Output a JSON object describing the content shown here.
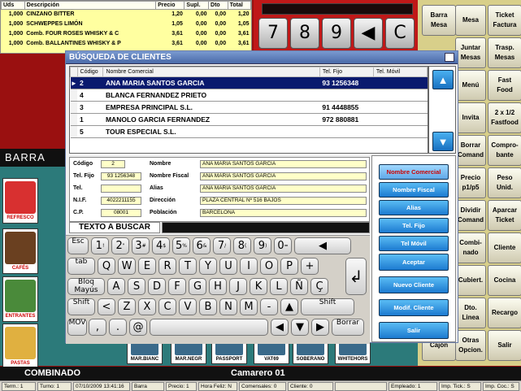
{
  "order": {
    "headers": [
      "Uds",
      "Descripción",
      "Precio",
      "Supl.",
      "Dto",
      "Total"
    ],
    "rows": [
      [
        "1,000",
        "CINZANO BITTER",
        "1,20",
        "0,00",
        "0,00",
        "1,20"
      ],
      [
        "1,000",
        "SCHWEPPES LIMÓN",
        "1,05",
        "0,00",
        "0,00",
        "1,05"
      ],
      [
        "1,000",
        "Comb. FOUR ROSES WHISKY & C",
        "3,61",
        "0,00",
        "0,00",
        "3,61"
      ],
      [
        "1,000",
        "Comb. BALLANTINES WHISKY & P",
        "3,61",
        "0,00",
        "0,00",
        "3,61"
      ]
    ]
  },
  "keypad": [
    "7",
    "8",
    "9",
    "◀",
    "C"
  ],
  "commands": [
    [
      "Barra Mesa",
      "Mesa",
      "Ticket Factura"
    ],
    [
      "",
      "Juntar Mesas",
      "Trasp. Mesas"
    ],
    [
      "",
      "Menú",
      "Fast Food"
    ],
    [
      "",
      "Invita",
      "2 x 1/2 Fastfood"
    ],
    [
      "",
      "Borrar Comand",
      "Compro- bante"
    ],
    [
      "",
      "Precio p1/p5",
      "Peso Unid."
    ],
    [
      "",
      "Dividir Comand",
      "Aparcar Ticket"
    ],
    [
      "",
      "Combi- nado",
      "Cliente"
    ],
    [
      "",
      "Cubiert.",
      "Cocina"
    ],
    [
      "",
      "Dto. Linea",
      "Recargo"
    ],
    [
      "Cajón",
      "Otras Opcion.",
      "Salir"
    ]
  ],
  "barra_label": "BARRA",
  "left_products": [
    "REFRESCO",
    "CAFÉS",
    "ENTRANTES",
    "PASTAS"
  ],
  "bottom_products": [
    "MAR.BIANC",
    "MAR.NEGR",
    "PASSPORT",
    "VAT69",
    "SOBERANO",
    "WHITEHORS"
  ],
  "dialog": {
    "title": "BÚSQUEDA DE CLIENTES",
    "columns": [
      "Código",
      "Nombre Comercial",
      "Tel. Fijo",
      "Tel. Móvil"
    ],
    "clients": [
      [
        "2",
        "ANA MARIA SANTOS GARCIA",
        "93 1256348",
        ""
      ],
      [
        "4",
        "BLANCA FERNANDEZ PRIETO",
        "",
        ""
      ],
      [
        "3",
        "EMPRESA PRINCIPAL S.L.",
        "91 4448855",
        ""
      ],
      [
        "1",
        "MANOLO GARCIA FERNANDEZ",
        "972 880881",
        ""
      ],
      [
        "5",
        "TOUR ESPECIAL S.L.",
        "",
        ""
      ]
    ],
    "form": {
      "codigo_label": "Código",
      "codigo": "2",
      "nombre_label": "Nombre",
      "nombre": "ANA MARIA SANTOS GARCIA",
      "telfijo_label": "Tel. Fijo",
      "telfijo": "93 1256348",
      "nombrefiscal_label": "Nombre Fiscal",
      "nombrefiscal": "ANA MARIA SANTOS GARCIA",
      "tel_label": "Tel.",
      "tel": "",
      "alias_label": "Alias",
      "alias": "ANA MARIA SANTOS GARCIA",
      "nif_label": "N.I.F.",
      "nif": "4022211155",
      "direccion_label": "Dirección",
      "direccion": "PLAZA CENTRAL Nº 516 BAJOS",
      "cp_label": "C.P.",
      "cp": "08001",
      "poblacion_label": "Población",
      "poblacion": "BARCELONA"
    },
    "search_label": "TEXTO A BUSCAR",
    "sort_buttons": [
      "Nombre Comercial",
      "Nombre Fiscal",
      "Alias",
      "Tel. Fijo",
      "Tel Móvil"
    ],
    "action_buttons": [
      "Aceptar",
      "Nuevo Cliente",
      "Modif. Cliente",
      "Salir"
    ]
  },
  "keyboard": {
    "row1": [
      "Esc",
      "1",
      "2",
      "3",
      "4",
      "5",
      "6",
      "7",
      "8",
      "9",
      "0",
      "◀"
    ],
    "row1_sup": [
      "",
      "!",
      "\"",
      "#",
      "$",
      "%",
      "&",
      "/",
      "(",
      ")",
      "=",
      ""
    ],
    "row2": [
      "tab",
      "Q",
      "W",
      "E",
      "R",
      "T",
      "Y",
      "U",
      "I",
      "O",
      "P",
      "+"
    ],
    "row3": [
      "Bloq Mayús",
      "A",
      "S",
      "D",
      "F",
      "G",
      "H",
      "J",
      "K",
      "L",
      "Ñ",
      "Ç"
    ],
    "row4": [
      "Shift",
      "<",
      "Z",
      "X",
      "C",
      "V",
      "B",
      "N",
      "M",
      "-",
      "▲",
      "Shift"
    ],
    "row5": [
      "MOV",
      ",",
      ".",
      "@",
      "",
      "◀",
      "▼",
      "▶",
      "Borrar"
    ],
    "enter": "↲"
  },
  "bottom_bar": {
    "left": "COMBINADO",
    "right": "Camarero 01"
  },
  "status": [
    "Term.: 1",
    "Turno: 1",
    "07/10/2009 13:41:16",
    "Barra",
    "Precio: 1",
    "Hora Feliz: N",
    "Comensales: 0",
    "Cliente: 0",
    "",
    "Empleado: 1",
    "Imp. Tick.: S",
    "Imp. Coc.: S"
  ]
}
